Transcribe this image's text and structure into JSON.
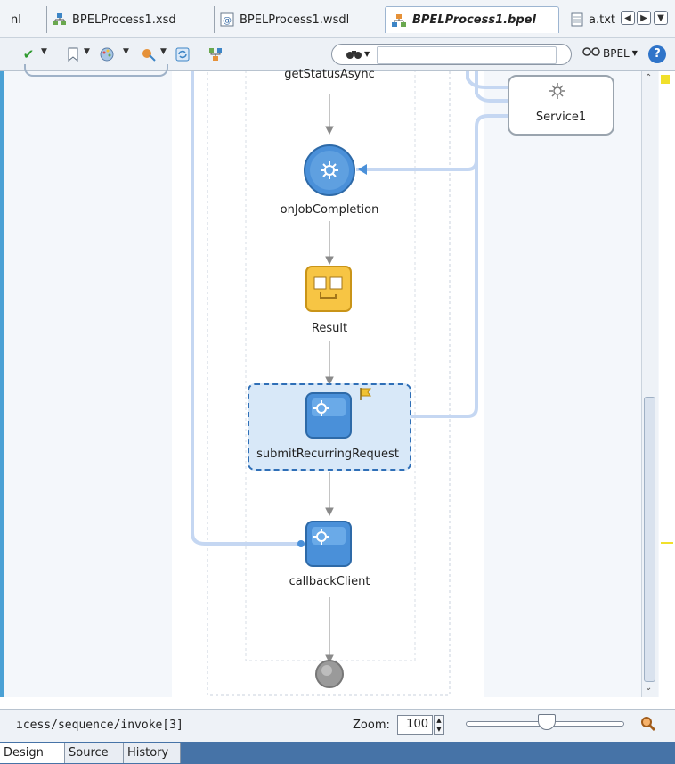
{
  "tabs": [
    {
      "label": "nl"
    },
    {
      "label": "BPELProcess1.xsd",
      "icon": "schema-icon"
    },
    {
      "label": "BPELProcess1.wsdl",
      "icon": "wsdl-icon"
    },
    {
      "label": "BPELProcess1.bpel",
      "icon": "bpel-icon",
      "active": true
    },
    {
      "label": "a.txt",
      "icon": "text-file-icon"
    }
  ],
  "toolbar": {
    "search_placeholder": "",
    "view_label": "BPEL",
    "help_label": "?"
  },
  "diagram": {
    "activities": [
      {
        "label": "getStatusAsync"
      },
      {
        "label": "onJobCompletion"
      },
      {
        "label": "Result"
      },
      {
        "label": "submitRecurringRequest",
        "selected": true
      },
      {
        "label": "callbackClient"
      }
    ],
    "partner_link": {
      "label": "Service1"
    }
  },
  "status": {
    "path": "ıcess/sequence/invoke[3]",
    "zoom_label": "Zoom:",
    "zoom_value": "100",
    "zoom_slider_fraction": 0.5
  },
  "bottom_tabs": [
    {
      "label": "Design",
      "active": true
    },
    {
      "label": "Source"
    },
    {
      "label": "History"
    }
  ],
  "colors": {
    "accent_blue": "#4a90d9",
    "link_blue": "#c5d7f2",
    "assign_yellow": "#f7c544",
    "selection_dash": "#2f6fb7"
  }
}
